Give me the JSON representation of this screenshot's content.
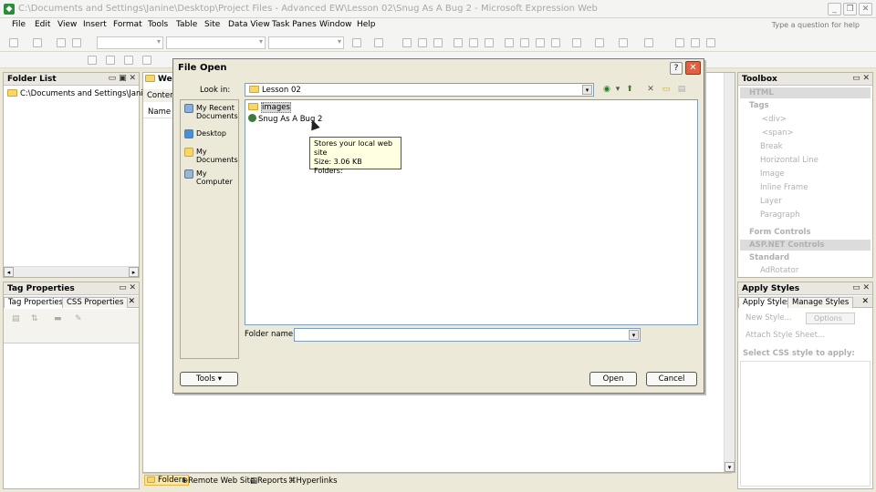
{
  "window": {
    "title": "C:\\Documents and Settings\\Janine\\Desktop\\Project Files - Advanced EW\\Lesson 02\\Snug As A Bug 2 - Microsoft Expression Web",
    "help_placeholder": "Type a question for help"
  },
  "menu": [
    "File",
    "Edit",
    "View",
    "Insert",
    "Format",
    "Tools",
    "Table",
    "Site",
    "Data View",
    "Task Panes",
    "Window",
    "Help"
  ],
  "folder_list": {
    "title": "Folder List",
    "root": "C:\\Documents and Settings\\Janine\\D"
  },
  "editor": {
    "tab_label": "We",
    "subtab": "Conten",
    "column": "Name"
  },
  "tag_properties": {
    "title": "Tag Properties",
    "tabs": [
      "Tag Properties",
      "CSS Properties"
    ]
  },
  "toolbox": {
    "title": "Toolbox",
    "html_cat": "HTML",
    "tags_cat": "Tags",
    "tags": [
      "<div>",
      "<span>",
      "Break",
      "Horizontal Line",
      "Image",
      "Inline Frame",
      "Layer",
      "Paragraph"
    ],
    "form_cat": "Form Controls",
    "aspnet_cat": "ASP.NET Controls",
    "standard_cat": "Standard",
    "standard_items": [
      "AdRotator"
    ]
  },
  "apply_styles": {
    "title": "Apply Styles",
    "tabs": [
      "Apply Styles",
      "Manage Styles"
    ],
    "new_style": "New Style...",
    "options": "Options",
    "attach": "Attach Style Sheet...",
    "select_label": "Select CSS style to apply:"
  },
  "statusbar": [
    "Folders",
    "Remote Web Site",
    "Reports",
    "Hyperlinks"
  ],
  "dialog": {
    "title": "File Open",
    "look_in_label": "Look in:",
    "look_in_value": "Lesson 02",
    "places": [
      {
        "label": "My Recent Documents"
      },
      {
        "label": "Desktop"
      },
      {
        "label": "My Documents"
      },
      {
        "label": "My Computer"
      }
    ],
    "files": [
      "images",
      "Snug As A Bug 2"
    ],
    "tooltip": {
      "line1": "Stores your local web site",
      "line2": "Size: 3.06 KB",
      "line3": "Folders:"
    },
    "folder_name_label": "Folder name:",
    "folder_name_value": "",
    "tools_button": "Tools",
    "open_button": "Open",
    "cancel_button": "Cancel"
  }
}
